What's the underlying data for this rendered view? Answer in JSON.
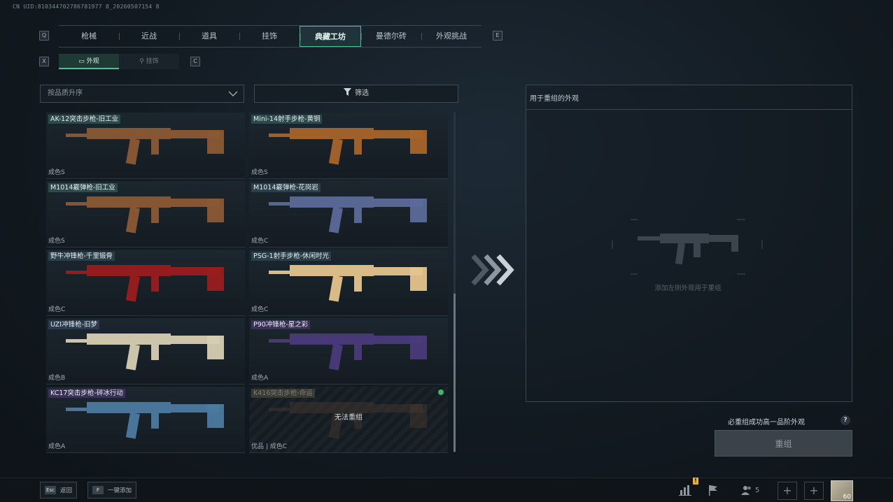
{
  "uid": "CN UID:810344702786781977 8_20260507154 8",
  "keys": {
    "q": "Q",
    "e": "E",
    "x": "X",
    "c": "C"
  },
  "tabs": [
    "枪械",
    "近战",
    "道具",
    "挂饰",
    "典藏工坊",
    "曼德尔砖",
    "外观挑战"
  ],
  "active_tab": "典藏工坊",
  "subtabs": [
    {
      "label": "外观",
      "icon": "skin-icon",
      "active": true
    },
    {
      "label": "挂饰",
      "icon": "charm-icon",
      "active": false
    }
  ],
  "sort": {
    "label": "按品质升序"
  },
  "filter": {
    "label": "筛选"
  },
  "items": [
    {
      "name": "AK-12突击步枪-旧工业",
      "grade": "成色S",
      "tier": "s",
      "color": "#8a5a34"
    },
    {
      "name": "Mini-14射手步枪-黄铜",
      "grade": "成色S",
      "tier": "s",
      "color": "#a8642a"
    },
    {
      "name": "M1014霰弹枪-旧工业",
      "grade": "成色S",
      "tier": "s",
      "color": "#8a5a34"
    },
    {
      "name": "M1014霰弹枪-花岗岩",
      "grade": "成色C",
      "tier": "c",
      "color": "#5c6a9a"
    },
    {
      "name": "野牛冲锋枪-千里锻骨",
      "grade": "成色C",
      "tier": "c",
      "color": "#9a1e1e"
    },
    {
      "name": "PSG-1射手步枪-休闲时光",
      "grade": "成色C",
      "tier": "c",
      "color": "#e3c48c"
    },
    {
      "name": "UZI冲锋枪-旧梦",
      "grade": "成色B",
      "tier": "b",
      "color": "#d6cdb2"
    },
    {
      "name": "P90冲锋枪-星之彩",
      "grade": "成色A",
      "tier": "a",
      "color": "#4a3a7a"
    },
    {
      "name": "KC17突击步枪-碎冰行动",
      "grade": "成色A",
      "tier": "a",
      "color": "#4c7aa0"
    },
    {
      "name": "K416突击步枪-命运",
      "grade": "优品 | 成色C",
      "tier": "x",
      "color": "#4a3a30",
      "disabled": true,
      "overlay": "无法重组"
    }
  ],
  "panel": {
    "title": "用于重组的外观",
    "hint": "添加左侧外观用于重组"
  },
  "requirement": "必重组成功高一品阶外观",
  "help": "?",
  "merge_button": "重组",
  "footer": {
    "esc_key": "Esc",
    "esc_label": "返回",
    "f_key": "F",
    "f_label": "一键添加",
    "badge": "!",
    "friends_count": "5",
    "plus": "+",
    "currency": "60"
  }
}
